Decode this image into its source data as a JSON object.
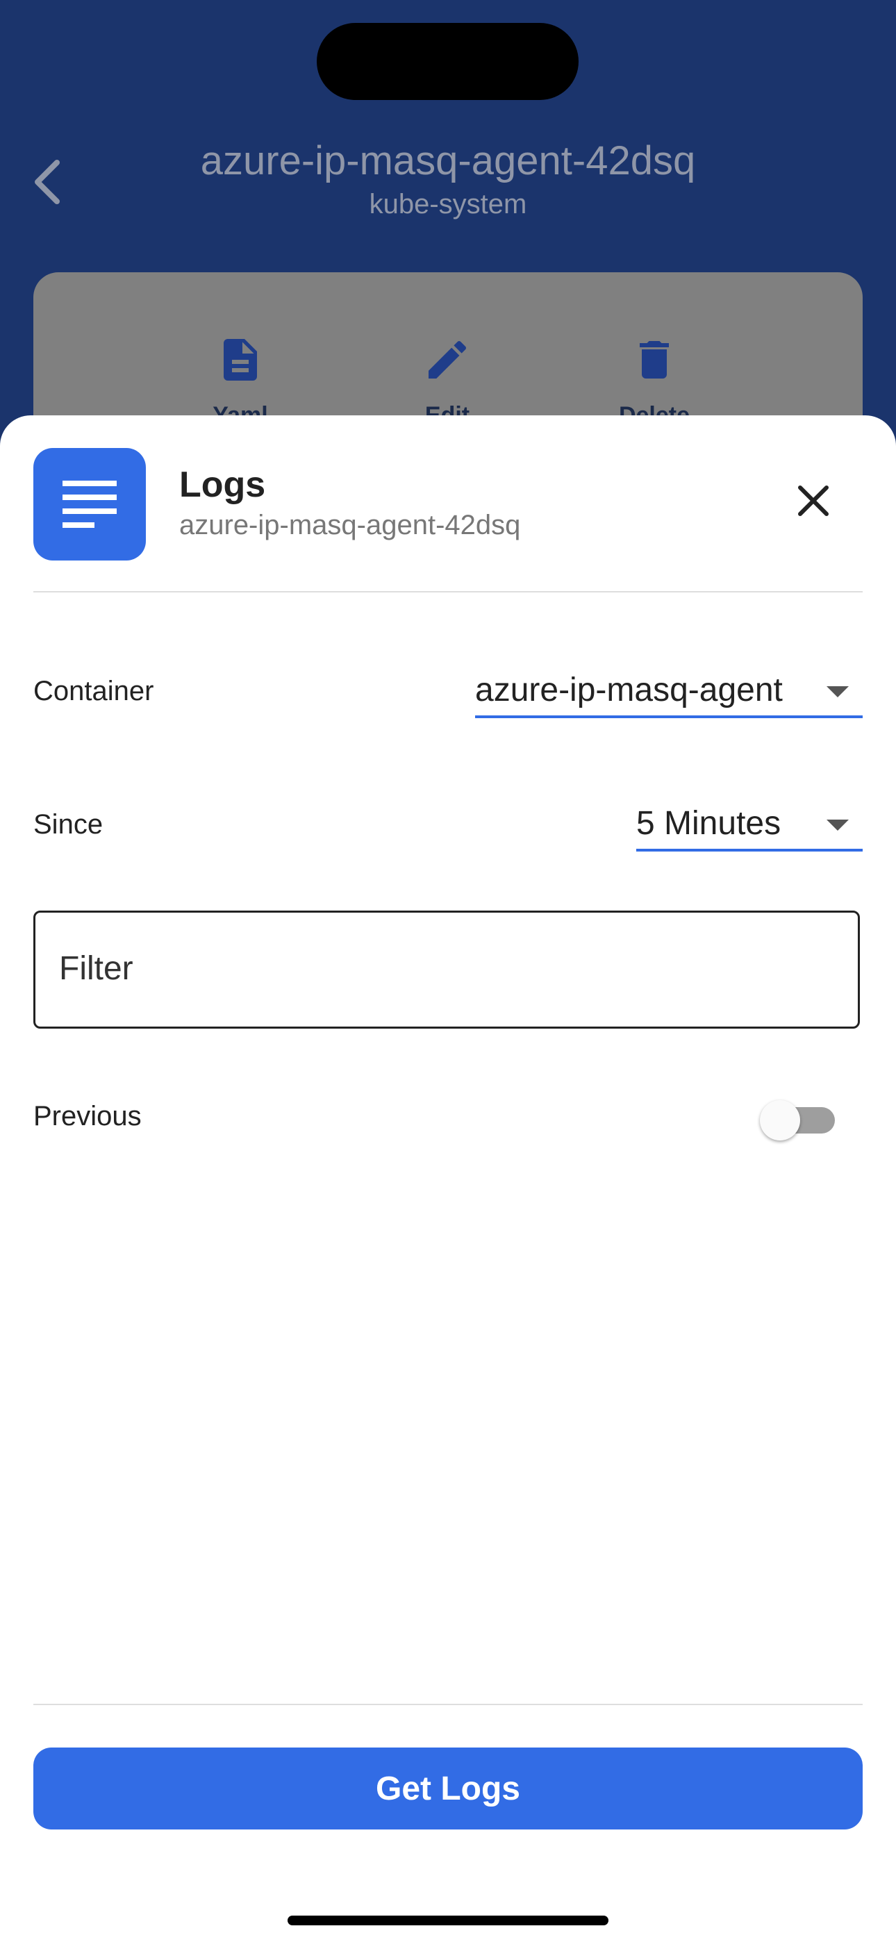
{
  "background": {
    "header": {
      "title": "azure-ip-masq-agent-42dsq",
      "subtitle": "kube-system"
    },
    "actions": [
      {
        "label": "Yaml",
        "icon": "document-icon"
      },
      {
        "label": "Edit",
        "icon": "pencil-icon"
      },
      {
        "label": "Delete",
        "icon": "trash-icon"
      }
    ]
  },
  "sheet": {
    "title": "Logs",
    "subtitle": "azure-ip-masq-agent-42dsq",
    "icon": "logs-icon",
    "container": {
      "label": "Container",
      "value": "azure-ip-masq-agent"
    },
    "since": {
      "label": "Since",
      "value": "5 Minutes"
    },
    "filter": {
      "placeholder": "Filter",
      "value": ""
    },
    "previous": {
      "label": "Previous",
      "enabled": false
    },
    "submit_label": "Get Logs"
  },
  "colors": {
    "accent": "#326ce5",
    "header_bg": "#1b346c"
  }
}
